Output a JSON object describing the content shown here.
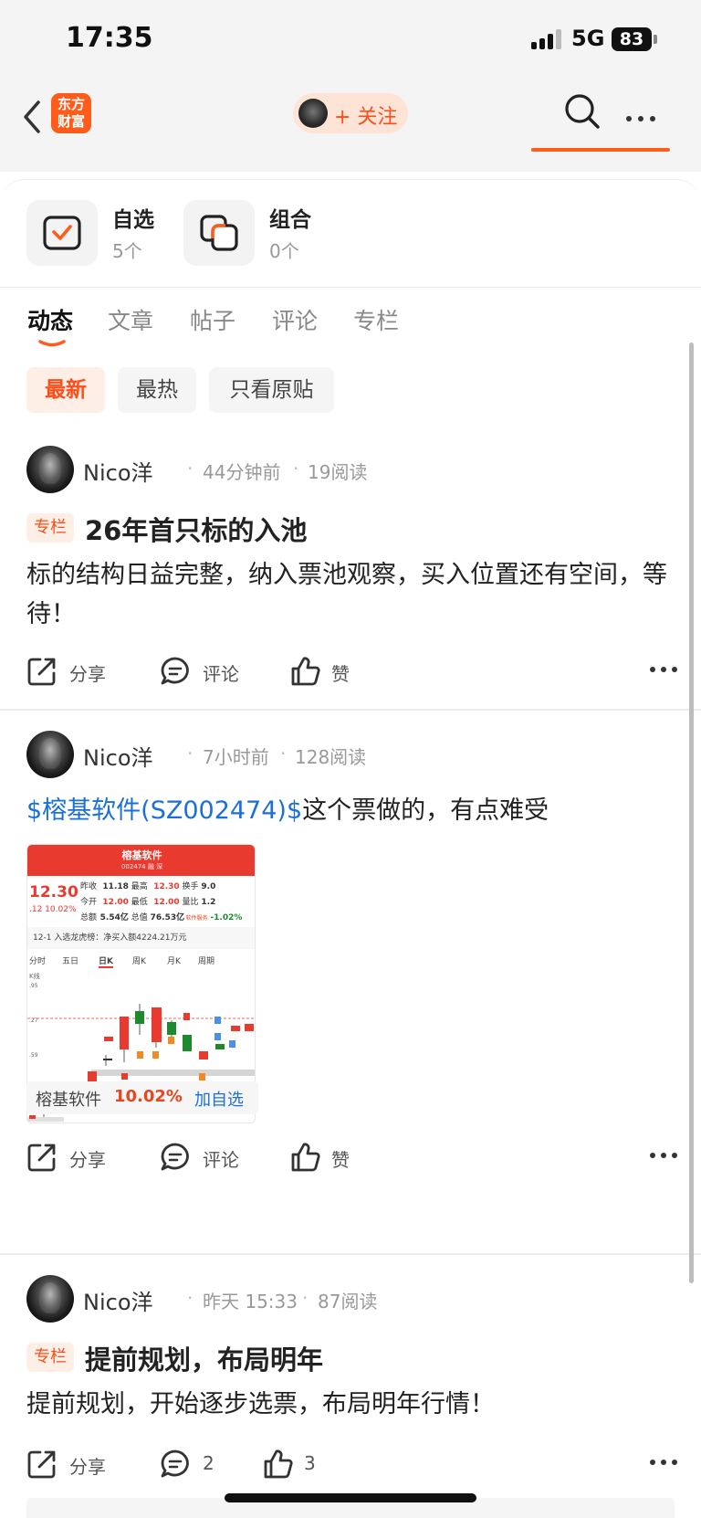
{
  "status_bar": {
    "time": "17:35",
    "network": "5G",
    "battery": "83"
  },
  "nav": {
    "logo_line1": "东方",
    "logo_line2": "财富",
    "follow_label": "+ 关注"
  },
  "quick": [
    {
      "title": "自选",
      "count": "5个"
    },
    {
      "title": "组合",
      "count": "0个"
    }
  ],
  "tabs": [
    "动态",
    "文章",
    "帖子",
    "评论",
    "专栏"
  ],
  "filters": [
    "最新",
    "最热",
    "只看原贴"
  ],
  "actions": {
    "share": "分享",
    "comment": "评论",
    "like": "赞"
  },
  "posts": [
    {
      "author": "Nico洋",
      "time": "44分钟前",
      "reads": "19阅读",
      "badge": "专栏",
      "title": "26年首只标的入池",
      "body": "标的结构日益完整，纳入票池观察，买入位置还有空间，等待！"
    },
    {
      "author": "Nico洋",
      "time": "7小时前",
      "reads": "128阅读",
      "stock_link": "$榕基软件(SZ002474)$",
      "body": "这个票做的，有点难受",
      "image": {
        "title": "榕基软件",
        "code": "002474 融 深",
        "price": "12.30",
        "change": ".12 10.02%",
        "rows": [
          [
            "昨收",
            "11.18",
            "最高",
            "12.30",
            "换手",
            "9.0"
          ],
          [
            "今开",
            "12.00",
            "最低",
            "12.00",
            "量比",
            "1.2"
          ],
          [
            "总额",
            "5.54亿",
            "总值",
            "76.53亿",
            "软件服务",
            "-1.02%"
          ]
        ],
        "notice": "12-1 入选龙虎榜：净买入额4224.21万元",
        "chart_tabs": [
          "分时",
          "五日",
          "日K",
          "周K",
          "月K",
          "周期"
        ],
        "axis_labels": [
          "K线",
          ".95",
          ".27",
          ".59"
        ]
      },
      "stock_chip": {
        "name": "榕基软件",
        "pct": "10.02%",
        "add": "加自选"
      }
    },
    {
      "author": "Nico洋",
      "time": "昨天 15:33",
      "reads": "87阅读",
      "badge": "专栏",
      "title": "提前规划，布局明年",
      "body": "提前规划，开始逐步选票，布局明年行情！",
      "comment_count": "2",
      "like_count": "3"
    }
  ],
  "colors": {
    "accent": "#ff4d1a",
    "link": "#1a6fdc",
    "red": "#e83a2e",
    "green": "#1e8a2e"
  }
}
